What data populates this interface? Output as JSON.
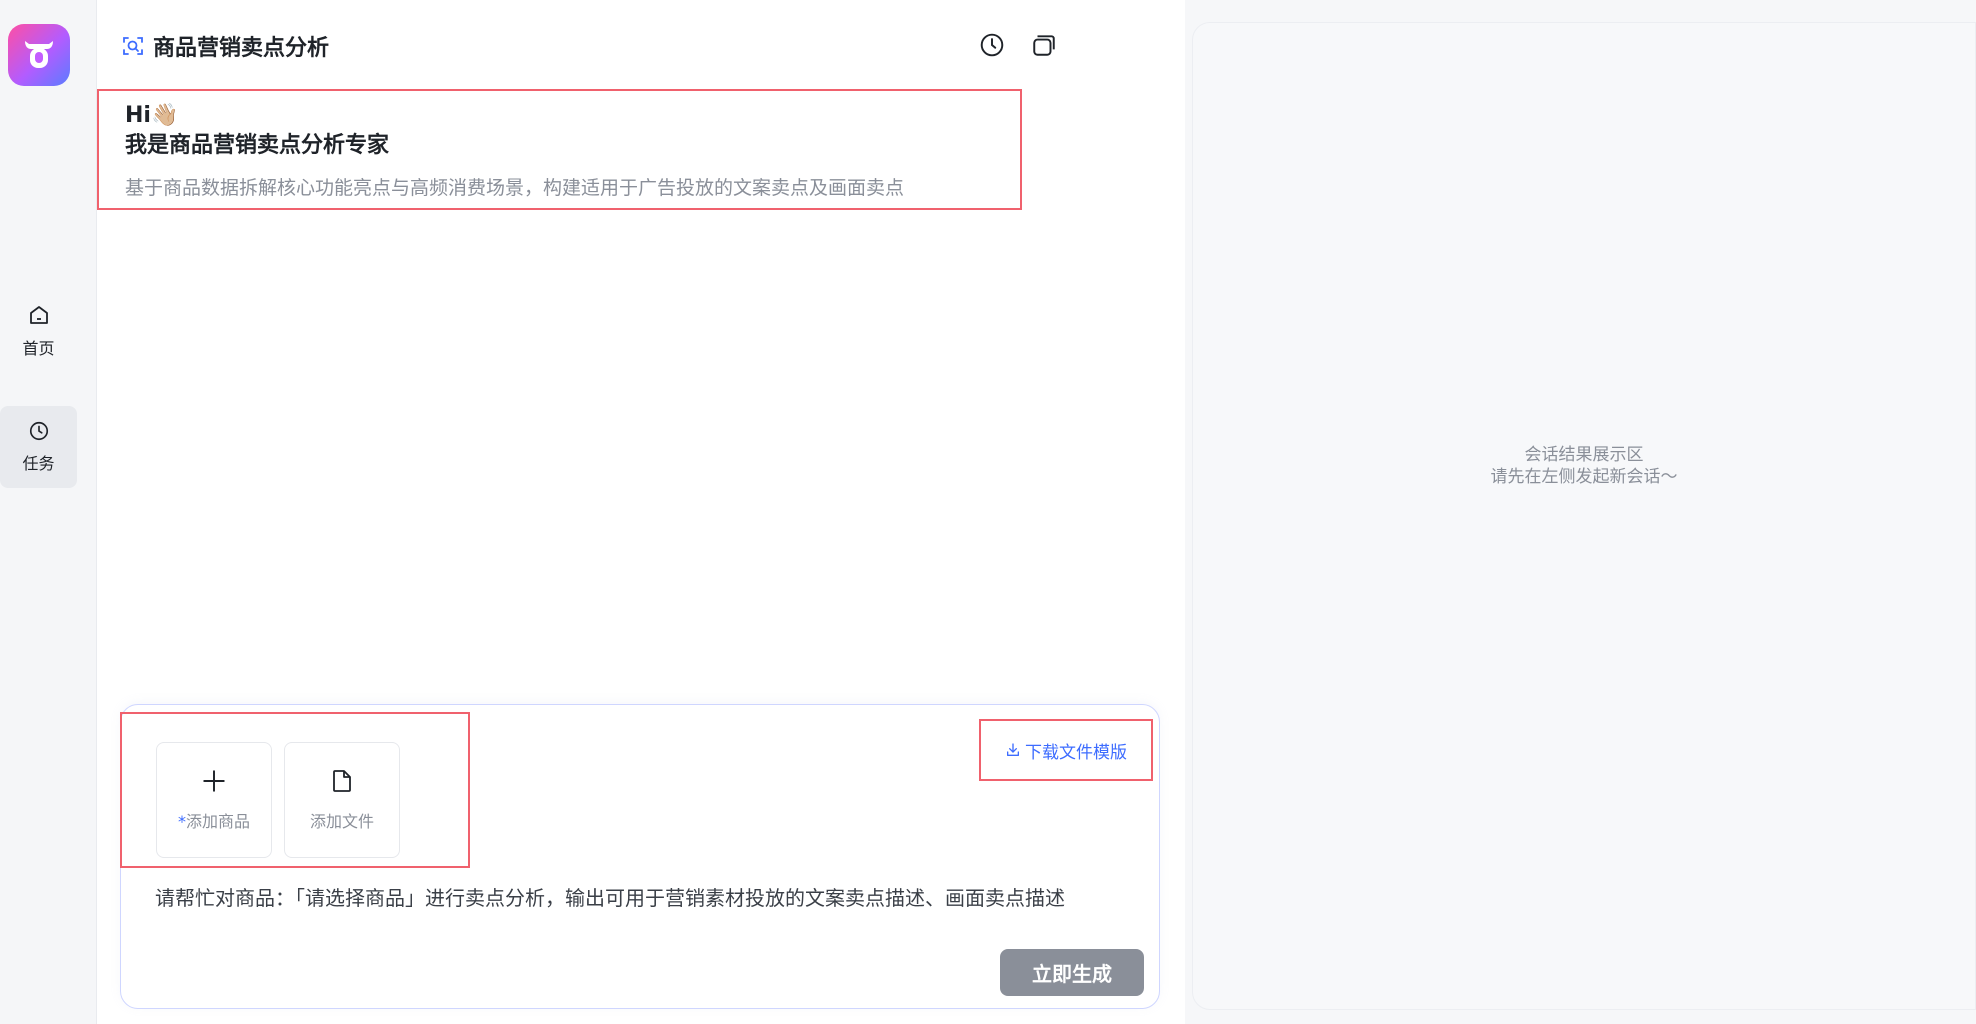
{
  "nav": {
    "home_label": "首页",
    "tasks_label": "任务"
  },
  "header": {
    "title": "商品营销卖点分析"
  },
  "intro": {
    "greeting": "Hi👋🏼",
    "role": "我是商品营销卖点分析专家",
    "description": "基于商品数据拆解核心功能亮点与高频消费场景，构建适用于广告投放的文案卖点及画面卖点"
  },
  "composer": {
    "add_product_required": "*",
    "add_product_label": "添加商品",
    "add_file_label": "添加文件",
    "download_template_label": "下载文件模版",
    "prompt_value": "请帮忙对商品：「请选择商品」进行卖点分析，输出可用于营销素材投放的文案卖点描述、画面卖点描述",
    "generate_label": "立即生成"
  },
  "result": {
    "line1": "会话结果展示区",
    "line2": "请先在左侧发起新会话～"
  },
  "colors": {
    "accent": "#3d6cff",
    "highlight_border": "#f0616d",
    "button_disabled": "#8a8f99"
  }
}
